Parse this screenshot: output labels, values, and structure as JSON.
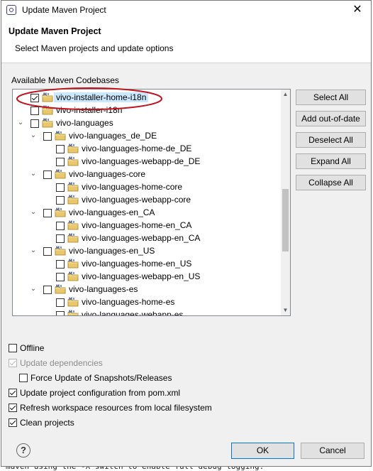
{
  "window": {
    "title": "Update Maven Project",
    "close_glyph": "✕"
  },
  "header": {
    "title": "Update Maven Project",
    "subtitle": "Select Maven projects and update options"
  },
  "codebases": {
    "label": "Available Maven Codebases",
    "rows": [
      {
        "label": "vivo-installer-home-i18n",
        "depth": 0,
        "checked": true,
        "expander": "",
        "selected": true
      },
      {
        "label": "vivo-installer-i18n",
        "depth": 0,
        "checked": false,
        "expander": ""
      },
      {
        "label": "vivo-languages",
        "depth": 0,
        "checked": false,
        "expander": "⌄"
      },
      {
        "label": "vivo-languages_de_DE",
        "depth": 1,
        "checked": false,
        "expander": "⌄"
      },
      {
        "label": "vivo-languages-home-de_DE",
        "depth": 2,
        "checked": false,
        "expander": ""
      },
      {
        "label": "vivo-languages-webapp-de_DE",
        "depth": 2,
        "checked": false,
        "expander": ""
      },
      {
        "label": "vivo-languages-core",
        "depth": 1,
        "checked": false,
        "expander": "⌄"
      },
      {
        "label": "vivo-languages-home-core",
        "depth": 2,
        "checked": false,
        "expander": ""
      },
      {
        "label": "vivo-languages-webapp-core",
        "depth": 2,
        "checked": false,
        "expander": ""
      },
      {
        "label": "vivo-languages-en_CA",
        "depth": 1,
        "checked": false,
        "expander": "⌄"
      },
      {
        "label": "vivo-languages-home-en_CA",
        "depth": 2,
        "checked": false,
        "expander": ""
      },
      {
        "label": "vivo-languages-webapp-en_CA",
        "depth": 2,
        "checked": false,
        "expander": ""
      },
      {
        "label": "vivo-languages-en_US",
        "depth": 1,
        "checked": false,
        "expander": "⌄"
      },
      {
        "label": "vivo-languages-home-en_US",
        "depth": 2,
        "checked": false,
        "expander": ""
      },
      {
        "label": "vivo-languages-webapp-en_US",
        "depth": 2,
        "checked": false,
        "expander": ""
      },
      {
        "label": "vivo-languages-es",
        "depth": 1,
        "checked": false,
        "expander": "⌄"
      },
      {
        "label": "vivo-languages-home-es",
        "depth": 2,
        "checked": false,
        "expander": ""
      },
      {
        "label": "vivo-languages-webapp-es",
        "depth": 2,
        "checked": false,
        "expander": ""
      }
    ]
  },
  "side_buttons": {
    "select_all": "Select All",
    "add_out_of_date": "Add out-of-date",
    "deselect_all": "Deselect All",
    "expand_all": "Expand All",
    "collapse_all": "Collapse All"
  },
  "options": {
    "offline": {
      "label": "Offline",
      "checked": false
    },
    "update_dependencies": {
      "label": "Update dependencies",
      "checked": true,
      "disabled": true
    },
    "force_update": {
      "label": "Force Update of Snapshots/Releases",
      "checked": false
    },
    "update_config": {
      "label": "Update project configuration from pom.xml",
      "checked": true
    },
    "refresh_workspace": {
      "label": "Refresh workspace resources from local filesystem",
      "checked": true
    },
    "clean_projects": {
      "label": "Clean projects",
      "checked": true
    }
  },
  "footer": {
    "help_glyph": "?",
    "ok_label": "OK",
    "cancel_label": "Cancel"
  },
  "background": {
    "bottom_text": "maven using the -X switch to enable full debug logging."
  },
  "colors": {
    "selection": "#cce8ff",
    "annotation": "#c0141e",
    "ok_border": "#0078d7"
  }
}
